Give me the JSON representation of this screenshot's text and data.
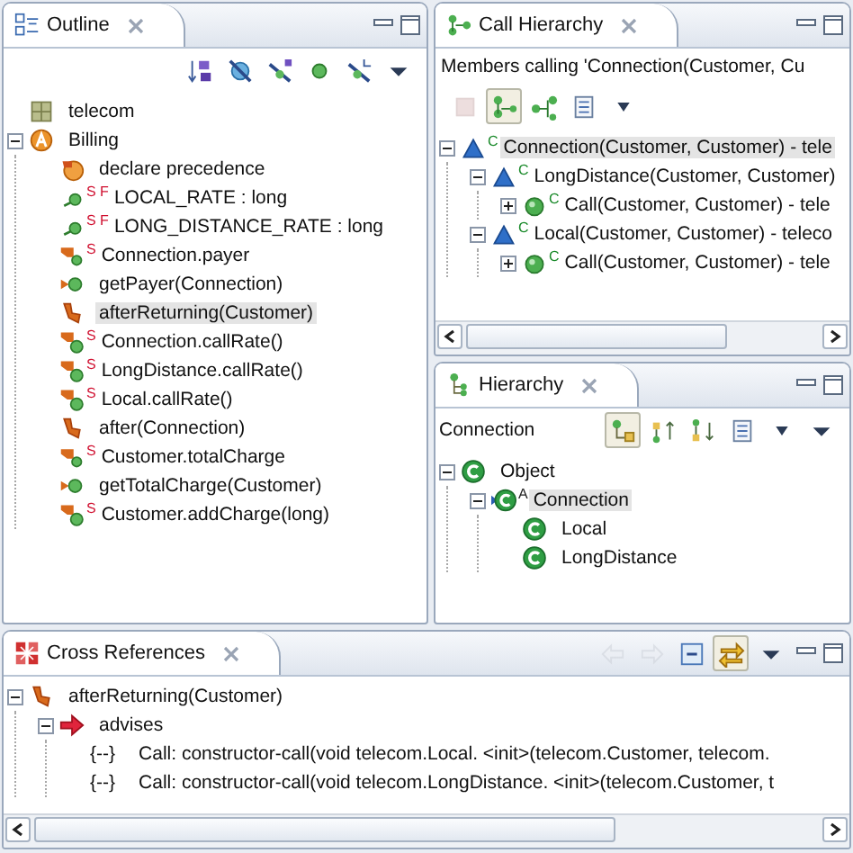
{
  "outline": {
    "title": "Outline",
    "toolbar": [
      {
        "kind": "sort",
        "pressed": false,
        "disabled": false
      },
      {
        "kind": "hide-fields",
        "pressed": false,
        "disabled": false
      },
      {
        "kind": "hide-static",
        "pressed": false,
        "disabled": false
      },
      {
        "kind": "hide-non-public",
        "pressed": false,
        "disabled": false
      },
      {
        "kind": "hide-local-types",
        "pressed": false,
        "disabled": false
      },
      {
        "kind": "view-menu",
        "pressed": false,
        "disabled": false
      }
    ],
    "tree": [
      {
        "label": "telecom",
        "kind": "package",
        "selected": false
      },
      {
        "label": "Billing",
        "kind": "aspect",
        "selected": false,
        "expanded": true,
        "children": [
          {
            "label": "declare precedence",
            "kind": "precedence",
            "selected": false
          },
          {
            "label": "LOCAL_RATE : long",
            "kind": "field",
            "badge": "S F",
            "selected": false
          },
          {
            "label": "LONG_DISTANCE_RATE : long",
            "kind": "field",
            "badge": "S F",
            "selected": false
          },
          {
            "label": "Connection.payer",
            "kind": "intertype-field",
            "badge": "S",
            "selected": false
          },
          {
            "label": "getPayer(Connection)",
            "kind": "method",
            "selected": false
          },
          {
            "label": "afterReturning(Customer)",
            "kind": "advice",
            "selected": true
          },
          {
            "label": "Connection.callRate()",
            "kind": "intertype-method",
            "badge": "S",
            "selected": false
          },
          {
            "label": "LongDistance.callRate()",
            "kind": "intertype-method",
            "badge": "S",
            "selected": false
          },
          {
            "label": "Local.callRate()",
            "kind": "intertype-method",
            "badge": "S",
            "selected": false
          },
          {
            "label": "after(Connection)",
            "kind": "advice",
            "selected": false
          },
          {
            "label": "Customer.totalCharge",
            "kind": "intertype-field",
            "badge": "S",
            "selected": false
          },
          {
            "label": "getTotalCharge(Customer)",
            "kind": "method",
            "selected": false
          },
          {
            "label": "Customer.addCharge(long)",
            "kind": "intertype-method",
            "badge": "S",
            "selected": false
          }
        ]
      }
    ]
  },
  "call_hierarchy": {
    "title": "Call Hierarchy",
    "header": "Members calling 'Connection(Customer, Cu",
    "toolbar": [
      {
        "kind": "stop",
        "pressed": false,
        "disabled": true
      },
      {
        "kind": "callers",
        "pressed": true,
        "disabled": false
      },
      {
        "kind": "callees",
        "pressed": false,
        "disabled": false
      },
      {
        "kind": "layout",
        "pressed": false,
        "disabled": false
      },
      {
        "kind": "dropdown",
        "pressed": false,
        "disabled": false
      }
    ],
    "tree": [
      {
        "label": "Connection(Customer, Customer) - tele",
        "kind": "protected-constructor",
        "badge": "C",
        "selected": true,
        "expanded": true,
        "children": [
          {
            "label": "LongDistance(Customer, Customer)",
            "kind": "protected-constructor",
            "badge": "C",
            "selected": false,
            "expanded": true,
            "children": [
              {
                "label": "Call(Customer, Customer) - tele",
                "kind": "public-constructor",
                "badge": "C",
                "selected": false,
                "expanded": false
              }
            ]
          },
          {
            "label": "Local(Customer, Customer) - teleco",
            "kind": "protected-constructor",
            "badge": "C",
            "selected": false,
            "expanded": true,
            "children": [
              {
                "label": "Call(Customer, Customer) - tele",
                "kind": "public-constructor",
                "badge": "C",
                "selected": false,
                "expanded": false
              }
            ]
          }
        ]
      }
    ]
  },
  "hierarchy": {
    "title": "Hierarchy",
    "focus": "Connection",
    "toolbar": [
      {
        "kind": "type-hierarchy",
        "pressed": true,
        "disabled": false
      },
      {
        "kind": "supertypes",
        "pressed": false,
        "disabled": false
      },
      {
        "kind": "subtypes",
        "pressed": false,
        "disabled": false
      },
      {
        "kind": "member-list",
        "pressed": false,
        "disabled": false
      },
      {
        "kind": "dropdown",
        "pressed": false,
        "disabled": false
      },
      {
        "kind": "view-menu",
        "pressed": false,
        "disabled": false
      }
    ],
    "tree": [
      {
        "label": "Object",
        "kind": "class",
        "selected": false,
        "expanded": true,
        "children": [
          {
            "label": "Connection",
            "kind": "abstract-class",
            "badge": "A",
            "selected": true,
            "expanded": true,
            "children": [
              {
                "label": "Local",
                "kind": "class",
                "selected": false
              },
              {
                "label": "LongDistance",
                "kind": "class",
                "selected": false
              }
            ]
          }
        ]
      }
    ]
  },
  "cross_references": {
    "title": "Cross References",
    "toolbar": [
      {
        "kind": "back",
        "pressed": false,
        "disabled": true
      },
      {
        "kind": "forward",
        "pressed": false,
        "disabled": true
      },
      {
        "kind": "collapse-all",
        "pressed": false,
        "disabled": false
      },
      {
        "kind": "link",
        "pressed": true,
        "disabled": false
      },
      {
        "kind": "view-menu",
        "pressed": false,
        "disabled": false
      }
    ],
    "tree": [
      {
        "label": "afterReturning(Customer)",
        "kind": "advice",
        "selected": false,
        "expanded": true,
        "children": [
          {
            "label": "advises",
            "kind": "relation",
            "selected": false,
            "expanded": true,
            "children": [
              {
                "label": "Call: constructor-call(void telecom.Local. <init>(telecom.Customer, telecom.",
                "kind": "join-point",
                "marker": "{--}",
                "selected": false
              },
              {
                "label": "Call: constructor-call(void telecom.LongDistance. <init>(telecom.Customer, t",
                "kind": "join-point",
                "marker": "{--}",
                "selected": false
              }
            ]
          }
        ]
      }
    ]
  }
}
